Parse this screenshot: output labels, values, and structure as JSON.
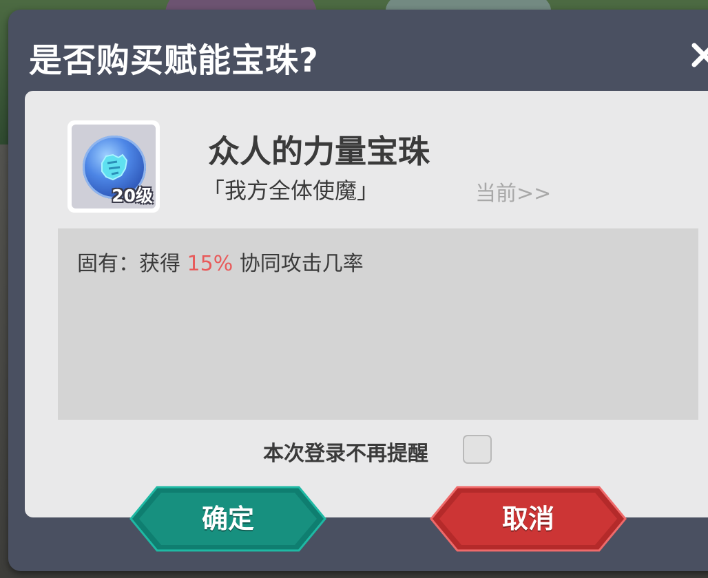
{
  "dialog": {
    "title": "是否购买赋能宝珠?",
    "close_icon": "close-x-icon"
  },
  "item": {
    "name": "众人的力量宝珠",
    "target": "「我方全体使魔」",
    "level_label": "20级",
    "current_link": "当前>>",
    "icon": "fist-orb-icon"
  },
  "description": {
    "prefix": "固有：获得 ",
    "value": "15%",
    "suffix": " 协同攻击几率"
  },
  "remind": {
    "label": "本次登录不再提醒",
    "checked": false
  },
  "buttons": {
    "confirm_label": "确定",
    "cancel_label": "取消"
  },
  "colors": {
    "confirm": "#17907f",
    "cancel": "#cc3535",
    "highlight": "#e85a5a",
    "frame": "#4a5061"
  }
}
